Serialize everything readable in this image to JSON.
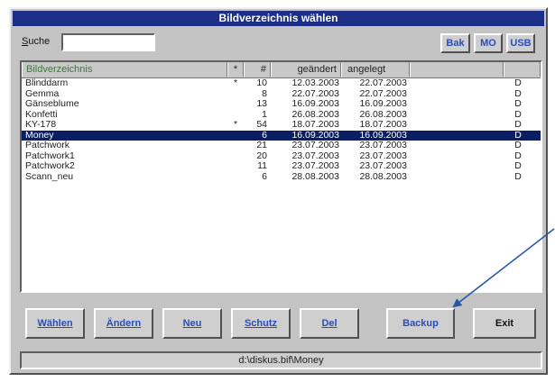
{
  "window": {
    "title": "Bildverzeichnis wählen"
  },
  "search": {
    "label_first": "S",
    "label_rest": "uche",
    "value": ""
  },
  "top_buttons": {
    "bak": "Bak",
    "mo": "MO",
    "usb": "USB"
  },
  "columns": {
    "name": "Bildverzeichnis",
    "star": "*",
    "count": "#",
    "modified": "geändert",
    "created": "angelegt"
  },
  "rows": [
    {
      "name": "Blinddarm",
      "star": "*",
      "count": "10",
      "modified": "12.03.2003",
      "created": "22.07.2003",
      "drive": "D"
    },
    {
      "name": "Gemma",
      "star": "",
      "count": "8",
      "modified": "22.07.2003",
      "created": "22.07.2003",
      "drive": "D"
    },
    {
      "name": "Gänseblume",
      "star": "",
      "count": "13",
      "modified": "16.09.2003",
      "created": "16.09.2003",
      "drive": "D"
    },
    {
      "name": "Konfetti",
      "star": "",
      "count": "1",
      "modified": "26.08.2003",
      "created": "26.08.2003",
      "drive": "D"
    },
    {
      "name": "KY-178",
      "star": "*",
      "count": "54",
      "modified": "18.07.2003",
      "created": "18.07.2003",
      "drive": "D"
    },
    {
      "name": "Money",
      "star": "",
      "count": "6",
      "modified": "16.09.2003",
      "created": "16.09.2003",
      "drive": "D",
      "selected": true
    },
    {
      "name": "Patchwork",
      "star": "",
      "count": "21",
      "modified": "23.07.2003",
      "created": "23.07.2003",
      "drive": "D"
    },
    {
      "name": "Patchwork1",
      "star": "",
      "count": "20",
      "modified": "23.07.2003",
      "created": "23.07.2003",
      "drive": "D"
    },
    {
      "name": "Patchwork2",
      "star": "",
      "count": "11",
      "modified": "23.07.2003",
      "created": "23.07.2003",
      "drive": "D"
    },
    {
      "name": "Scann_neu",
      "star": "",
      "count": "6",
      "modified": "28.08.2003",
      "created": "28.08.2003",
      "drive": "D"
    }
  ],
  "bottom_buttons": {
    "select": "Wählen",
    "change": "Ändern",
    "new": "Neu",
    "protect": "Schutz",
    "delete": "Del",
    "backup": "Backup",
    "exit": "Exit"
  },
  "status": {
    "path": "d:\\diskus.bif\\Money"
  },
  "colors": {
    "title_bar": "#1c2f86",
    "selection": "#0a1f63",
    "button_text": "#2a4dbd",
    "annotation_arrow": "#2356a8"
  }
}
